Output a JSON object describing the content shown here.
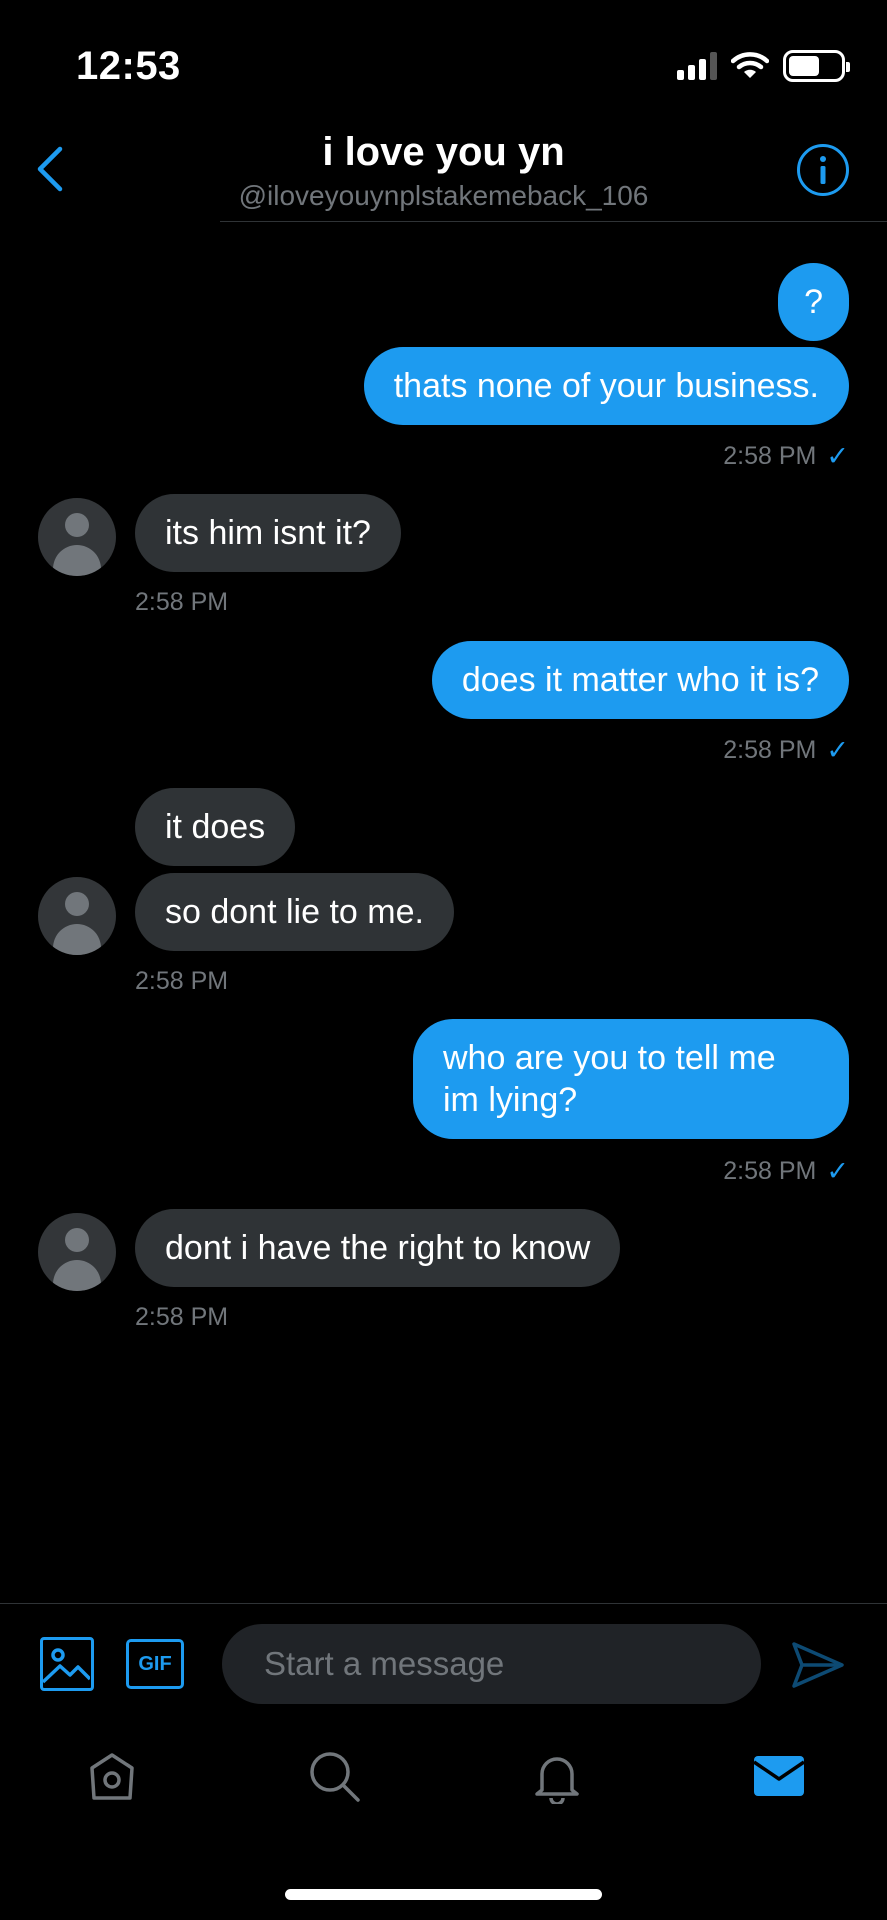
{
  "status_bar": {
    "time": "12:53"
  },
  "header": {
    "title": "i love you yn",
    "handle": "@iloveyouynplstakemeback_106"
  },
  "messages": [
    {
      "direction": "out",
      "text": "?"
    },
    {
      "direction": "out",
      "text": "thats none of your business.",
      "time": "2:58 PM"
    },
    {
      "direction": "in",
      "text": "its him isnt it?",
      "time": "2:58 PM"
    },
    {
      "direction": "out",
      "text": "does it matter who it is?",
      "time": "2:58 PM"
    },
    {
      "direction": "in",
      "text": "it does"
    },
    {
      "direction": "in",
      "text": "so dont lie to me.",
      "time": "2:58 PM"
    },
    {
      "direction": "out",
      "text": "who are you to tell me im lying?",
      "text_lines": [
        "who are you to tell me",
        "im lying?"
      ],
      "time": "2:58 PM"
    },
    {
      "direction": "in",
      "text": "dont i have the right to know",
      "time": "2:58 PM"
    }
  ],
  "composer": {
    "placeholder": "Start a message",
    "gif_label": "GIF"
  },
  "colors": {
    "accent": "#1d9bf0",
    "incoming_bubble": "#2f3336",
    "background": "#000000",
    "muted_text": "#71767b"
  },
  "icons": {
    "back": "chevron-left-icon",
    "info": "info-icon",
    "image": "image-icon",
    "gif": "gif-icon",
    "send": "send-icon",
    "home": "home-icon",
    "search": "search-icon",
    "notifications": "bell-icon",
    "messages": "mail-icon"
  },
  "tabs": [
    {
      "name": "home",
      "active": false
    },
    {
      "name": "search",
      "active": false
    },
    {
      "name": "notifications",
      "active": false
    },
    {
      "name": "messages",
      "active": true
    }
  ]
}
